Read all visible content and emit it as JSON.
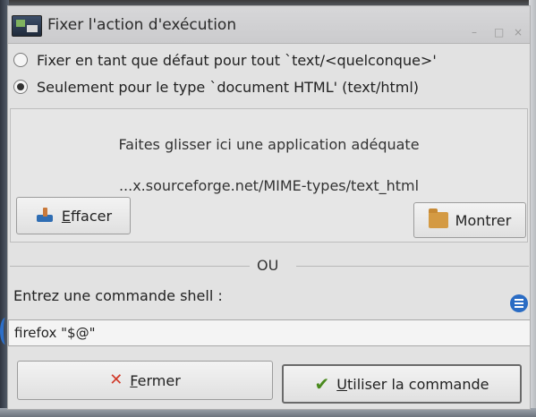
{
  "window": {
    "title": "Fixer l'action d'exécution",
    "controls": {
      "minimize": "–",
      "maximize": "□",
      "close": "×"
    }
  },
  "options": [
    {
      "label": "Fixer en tant que défaut pour tout `text/<quelconque>'",
      "selected": false
    },
    {
      "label": "Seulement pour le type `document HTML' (text/html)",
      "selected": true
    }
  ],
  "drop_area": {
    "hint": "Faites glisser ici une application adéquate",
    "url": "...x.sourceforge.net/MIME-types/text_html"
  },
  "buttons": {
    "effacer": {
      "mnemonic": "E",
      "rest": "ffacer"
    },
    "montrer": {
      "label": "Montrer"
    },
    "fermer": {
      "mnemonic": "F",
      "rest": "ermer"
    },
    "utiliser": {
      "mnemonic": "U",
      "rest": "tiliser la commande"
    }
  },
  "separator": "OU",
  "command": {
    "label": "Entrez une commande shell :",
    "value": "firefox \"$@\""
  },
  "icons": {
    "app": "mime-editor-icon",
    "clear": "clear-icon",
    "folder": "folder-icon",
    "info": "info-icon",
    "close": "x-icon",
    "confirm": "checkmark-icon"
  }
}
